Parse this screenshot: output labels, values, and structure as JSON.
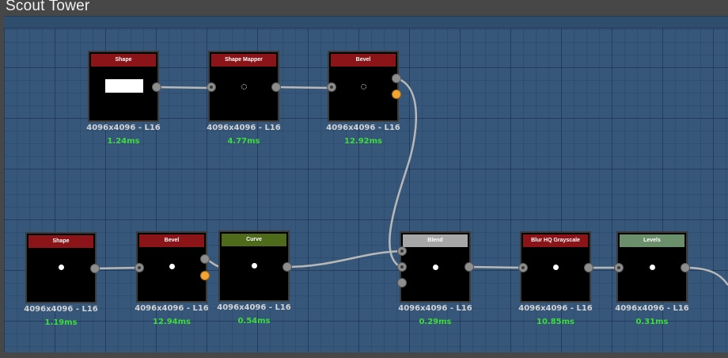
{
  "window": {
    "title": "Scout Tower"
  },
  "nodes": [
    {
      "id": "shape-1",
      "title": "Shape",
      "resolution": "4096x4096 - L16",
      "time": "1.24ms",
      "header_color": "#8b1419"
    },
    {
      "id": "shape-mapper",
      "title": "Shape Mapper",
      "resolution": "4096x4096 - L16",
      "time": "4.77ms",
      "header_color": "#8b1419"
    },
    {
      "id": "bevel-1",
      "title": "Bevel",
      "resolution": "4096x4096 - L16",
      "time": "12.92ms",
      "header_color": "#8b1419"
    },
    {
      "id": "shape-2",
      "title": "Shape",
      "resolution": "4096x4096 - L16",
      "time": "1.19ms",
      "header_color": "#8b1419"
    },
    {
      "id": "bevel-2",
      "title": "Bevel",
      "resolution": "4096x4096 - L16",
      "time": "12.94ms",
      "header_color": "#8b1419"
    },
    {
      "id": "curve",
      "title": "Curve",
      "resolution": "4096x4096 - L16",
      "time": "0.54ms",
      "header_color": "#4e6a1b"
    },
    {
      "id": "blend",
      "title": "Blend",
      "resolution": "4096x4096 - L16",
      "time": "0.29ms",
      "header_color": "#a7a7a7"
    },
    {
      "id": "blur-hq",
      "title": "Blur HQ Grayscale",
      "resolution": "4096x4096 - L16",
      "time": "10.85ms",
      "header_color": "#8b1419"
    },
    {
      "id": "levels",
      "title": "Levels",
      "resolution": "4096x4096 - L16",
      "time": "0.31ms",
      "header_color": "#6b8f6b"
    }
  ],
  "colors": {
    "canvas": "#36577a",
    "wire": "#b8b8b8",
    "time_text": "#3cdd3c",
    "port_orange": "#f3a531"
  }
}
